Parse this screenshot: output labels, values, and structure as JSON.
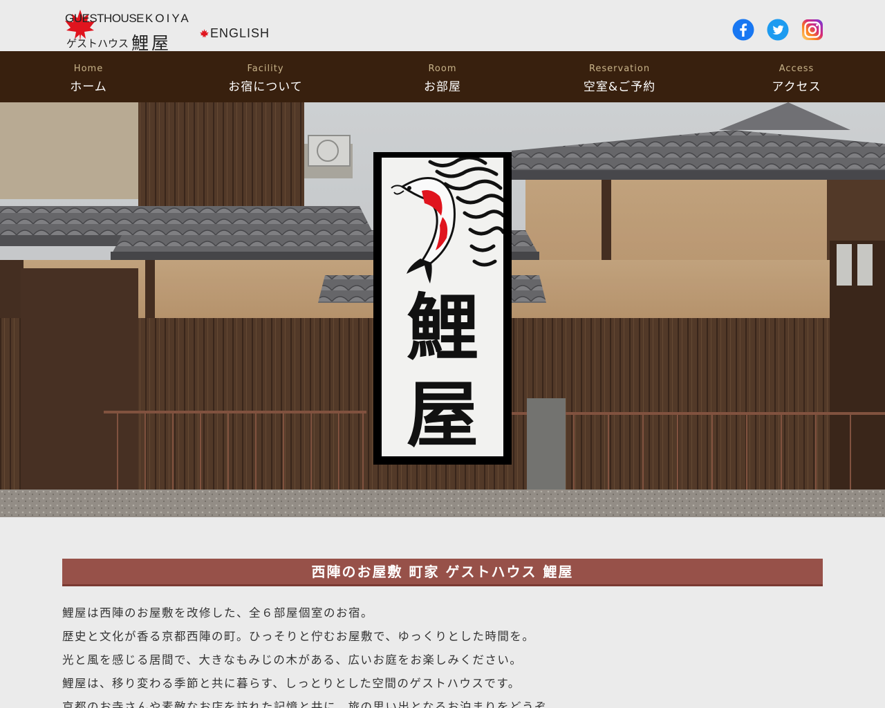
{
  "logo": {
    "line1_a": "GUESTHOUSE",
    "line1_b": "KOIYA",
    "line2_a": "ゲストハウス",
    "line2_b": "鯉屋"
  },
  "header": {
    "english_label": "ENGLISH"
  },
  "social": [
    {
      "name": "facebook-icon",
      "color": "#1877f2"
    },
    {
      "name": "twitter-icon",
      "color": "#1d9bf0"
    },
    {
      "name": "instagram-icon",
      "color": "#e1306c"
    }
  ],
  "nav": [
    {
      "en": "Home",
      "jp": "ホーム"
    },
    {
      "en": "Facility",
      "jp": "お宿について"
    },
    {
      "en": "Room",
      "jp": "お部屋"
    },
    {
      "en": "Reservation",
      "jp": "空室&ご予約"
    },
    {
      "en": "Access",
      "jp": "アクセス"
    }
  ],
  "hero": {
    "scroll_text": "鯉屋"
  },
  "main": {
    "title": "西陣のお屋敷 町家 ゲストハウス 鯉屋",
    "paragraphs": [
      "鯉屋は西陣のお屋敷を改修した、全６部屋個室のお宿。",
      "歴史と文化が香る京都西陣の町。ひっそりと佇むお屋敷で、ゆっくりとした時間を。",
      "光と風を感じる居間で、大きなもみじの木がある、広いお庭をお楽しみください。",
      "鯉屋は、移り変わる季節と共に暮らす、しっとりとした空間のゲストハウスです。",
      "京都のお寺さんや素敵なお店を訪れた記憶と共に、旅の思い出となるお泊まりをどうぞ。"
    ]
  },
  "colors": {
    "nav_bg": "#38200e",
    "nav_en": "#c9b48a",
    "title_bg": "#975149",
    "page_bg": "#ebebeb",
    "maple_red": "#e0141e"
  }
}
